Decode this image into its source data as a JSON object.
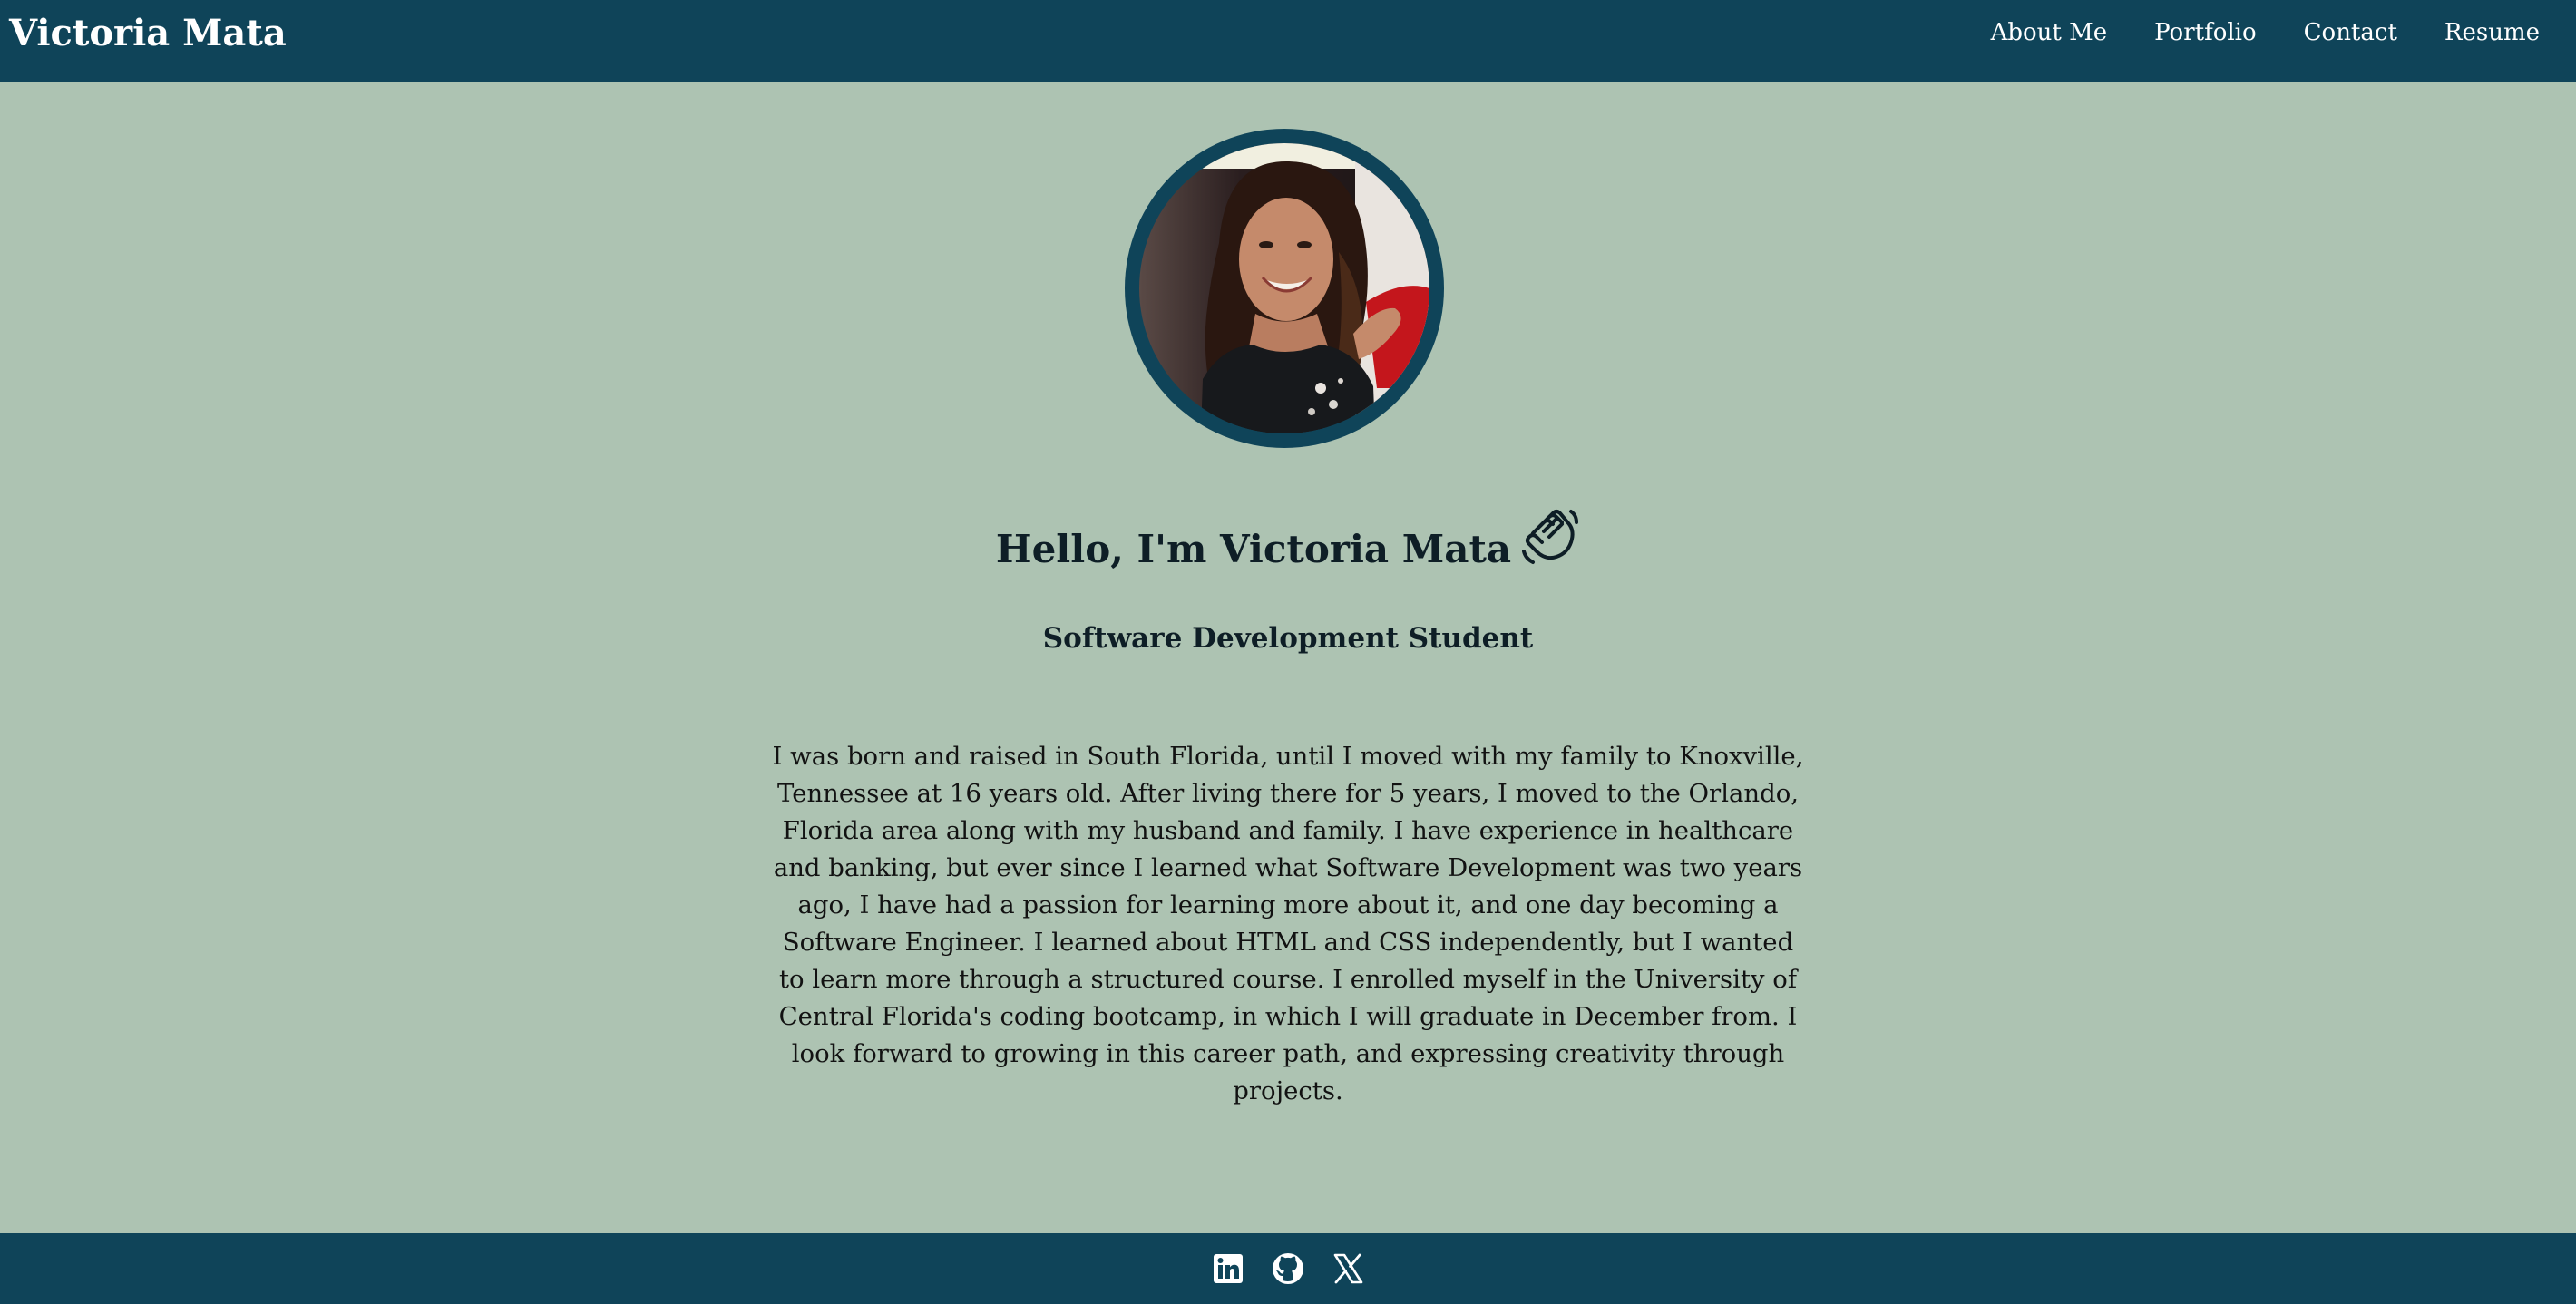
{
  "header": {
    "brand": "Victoria Mata",
    "nav": [
      {
        "label": "About Me"
      },
      {
        "label": "Portfolio"
      },
      {
        "label": "Contact"
      },
      {
        "label": "Resume"
      }
    ]
  },
  "hero": {
    "avatar_icon": "profile-photo",
    "greeting": "Hello, I'm Victoria Mata",
    "greeting_icon": "waving-hand-icon",
    "subtitle": "Software Development Student",
    "bio": "I was born and raised in South Florida, until I moved with my family to Knoxville, Tennessee at 16 years old. After living there for 5 years, I moved to the Orlando, Florida area along with my husband and family. I have experience in healthcare and banking, but ever since I learned what Software Development was two years ago, I have had a passion for learning more about it, and one day becoming a Software Engineer. I learned about HTML and CSS independently, but I wanted to learn more through a structured course. I enrolled myself in the University of Central Florida's coding bootcamp, in which I will graduate in December from. I look forward to growing in this career path, and expressing creativity through projects."
  },
  "footer": {
    "social": [
      {
        "icon": "linkedin-icon"
      },
      {
        "icon": "github-icon"
      },
      {
        "icon": "x-twitter-icon"
      }
    ]
  },
  "colors": {
    "header_bg": "#0f4459",
    "page_bg": "#adc3b2",
    "text": "#0e1e26"
  }
}
